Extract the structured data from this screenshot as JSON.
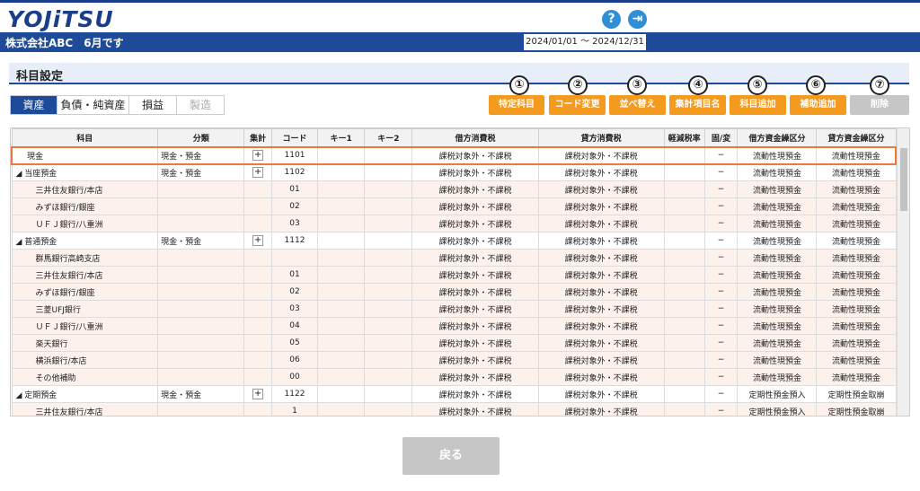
{
  "app": {
    "logo": "YOJiTSU",
    "help_icon": "?",
    "logout_icon": "⇥"
  },
  "header": {
    "company": "株式会社ABC　6月です",
    "period": "2024/01/01 ～ 2024/12/31"
  },
  "page_title": "科目設定",
  "tabs": [
    {
      "label": "資産",
      "state": "active"
    },
    {
      "label": "負債・純資産",
      "state": "normal"
    },
    {
      "label": "損益",
      "state": "normal"
    },
    {
      "label": "製造",
      "state": "disabled"
    }
  ],
  "toolbar": [
    {
      "num": "①",
      "label": "特定科目"
    },
    {
      "num": "②",
      "label": "コード変更"
    },
    {
      "num": "③",
      "label": "並べ替え"
    },
    {
      "num": "④",
      "label": "集計項目名"
    },
    {
      "num": "⑤",
      "label": "科目追加"
    },
    {
      "num": "⑥",
      "label": "補助追加"
    },
    {
      "num": "⑦",
      "label": "削除"
    }
  ],
  "table": {
    "headers": [
      "科目",
      "分類",
      "集計",
      "コード",
      "キー1",
      "キー2",
      "借方消費税",
      "貸方消費税",
      "軽減税率",
      "固/変",
      "借方資金繰区分",
      "貸方資金繰区分"
    ],
    "rows": [
      {
        "type": "sel",
        "name": "現金",
        "cat": "現金・預金",
        "plus": "+",
        "code": "1101",
        "dtax": "課税対象外・不課税",
        "ctax": "課税対象外・不課税",
        "fv": "−",
        "dcash": "流動性現預金",
        "ccash": "流動性現預金"
      },
      {
        "type": "main",
        "name": "◢ 当座預金",
        "cat": "現金・預金",
        "plus": "+",
        "code": "1102",
        "dtax": "課税対象外・不課税",
        "ctax": "課税対象外・不課税",
        "fv": "−",
        "dcash": "流動性現預金",
        "ccash": "流動性現預金"
      },
      {
        "type": "sub",
        "name": "三井住友銀行/本店",
        "code": "01",
        "dtax": "課税対象外・不課税",
        "ctax": "課税対象外・不課税",
        "fv": "−",
        "dcash": "流動性現預金",
        "ccash": "流動性現預金"
      },
      {
        "type": "sub",
        "name": "みずほ銀行/銀座",
        "code": "02",
        "dtax": "課税対象外・不課税",
        "ctax": "課税対象外・不課税",
        "fv": "−",
        "dcash": "流動性現預金",
        "ccash": "流動性現預金"
      },
      {
        "type": "sub",
        "name": "ＵＦＪ銀行/八重洲",
        "code": "03",
        "dtax": "課税対象外・不課税",
        "ctax": "課税対象外・不課税",
        "fv": "−",
        "dcash": "流動性現預金",
        "ccash": "流動性現預金"
      },
      {
        "type": "main",
        "name": "◢ 普通預金",
        "cat": "現金・預金",
        "plus": "+",
        "code": "1112",
        "dtax": "課税対象外・不課税",
        "ctax": "課税対象外・不課税",
        "fv": "−",
        "dcash": "流動性現預金",
        "ccash": "流動性現預金"
      },
      {
        "type": "sub",
        "name": "群馬銀行高崎支店",
        "code": "",
        "dtax": "課税対象外・不課税",
        "ctax": "課税対象外・不課税",
        "fv": "−",
        "dcash": "流動性現預金",
        "ccash": "流動性現預金"
      },
      {
        "type": "sub",
        "name": "三井住友銀行/本店",
        "code": "01",
        "dtax": "課税対象外・不課税",
        "ctax": "課税対象外・不課税",
        "fv": "−",
        "dcash": "流動性現預金",
        "ccash": "流動性現預金"
      },
      {
        "type": "sub",
        "name": "みずほ銀行/銀座",
        "code": "02",
        "dtax": "課税対象外・不課税",
        "ctax": "課税対象外・不課税",
        "fv": "−",
        "dcash": "流動性現預金",
        "ccash": "流動性現預金"
      },
      {
        "type": "sub",
        "name": "三菱UFJ銀行",
        "code": "03",
        "dtax": "課税対象外・不課税",
        "ctax": "課税対象外・不課税",
        "fv": "−",
        "dcash": "流動性現預金",
        "ccash": "流動性現預金"
      },
      {
        "type": "sub",
        "name": "ＵＦＪ銀行/八重洲",
        "code": "04",
        "dtax": "課税対象外・不課税",
        "ctax": "課税対象外・不課税",
        "fv": "−",
        "dcash": "流動性現預金",
        "ccash": "流動性現預金"
      },
      {
        "type": "sub",
        "name": "楽天銀行",
        "code": "05",
        "dtax": "課税対象外・不課税",
        "ctax": "課税対象外・不課税",
        "fv": "−",
        "dcash": "流動性現預金",
        "ccash": "流動性現預金"
      },
      {
        "type": "sub",
        "name": "横浜銀行/本店",
        "code": "06",
        "dtax": "課税対象外・不課税",
        "ctax": "課税対象外・不課税",
        "fv": "−",
        "dcash": "流動性現預金",
        "ccash": "流動性現預金"
      },
      {
        "type": "sub",
        "name": "その他補助",
        "code": "00",
        "dtax": "課税対象外・不課税",
        "ctax": "課税対象外・不課税",
        "fv": "−",
        "dcash": "流動性現預金",
        "ccash": "流動性現預金"
      },
      {
        "type": "main",
        "name": "◢ 定期預金",
        "cat": "現金・預金",
        "plus": "+",
        "code": "1122",
        "dtax": "課税対象外・不課税",
        "ctax": "課税対象外・不課税",
        "fv": "−",
        "dcash": "定期性預金預入",
        "ccash": "定期性預金取崩"
      },
      {
        "type": "sub",
        "name": "三井住友銀行/本店",
        "code": "1",
        "dtax": "課税対象外・不課税",
        "ctax": "課税対象外・不課税",
        "fv": "−",
        "dcash": "定期性預金預入",
        "ccash": "定期性預金取崩"
      }
    ]
  },
  "back_label": "戻る"
}
